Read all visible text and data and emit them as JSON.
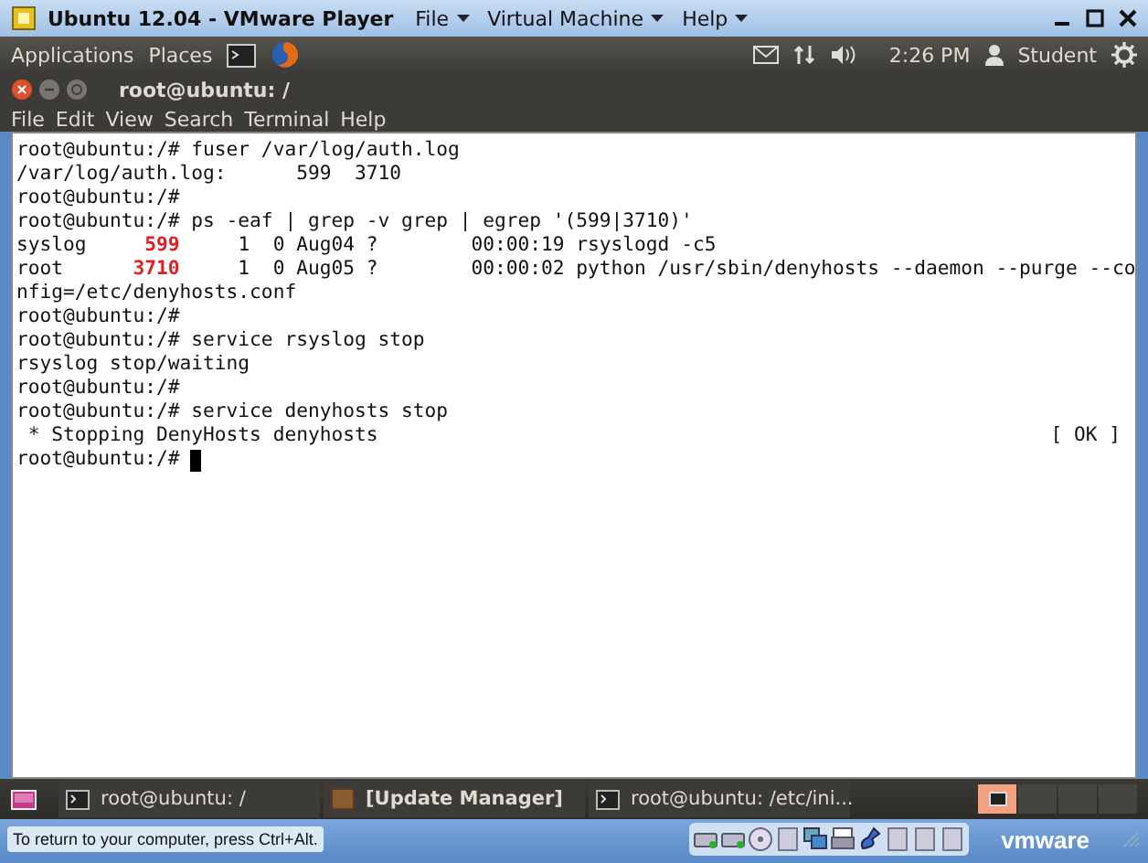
{
  "window": {
    "title": "Ubuntu 12.04 - VMware Player",
    "menus": [
      "File",
      "Virtual Machine",
      "Help"
    ]
  },
  "top_panel": {
    "menus": [
      "Applications",
      "Places"
    ],
    "clock": "2:26 PM",
    "user": "Student"
  },
  "terminal": {
    "title": "root@ubuntu: /",
    "menus": [
      "File",
      "Edit",
      "View",
      "Search",
      "Terminal",
      "Help"
    ],
    "lines": [
      {
        "parts": [
          {
            "kind": "plain",
            "text": "root@ubuntu:/# fuser /var/log/auth.log"
          }
        ]
      },
      {
        "parts": [
          {
            "kind": "plain",
            "text": "/var/log/auth.log:      599  3710"
          }
        ]
      },
      {
        "parts": [
          {
            "kind": "plain",
            "text": "root@ubuntu:/#"
          }
        ]
      },
      {
        "parts": [
          {
            "kind": "plain",
            "text": "root@ubuntu:/# ps -eaf | grep -v grep | egrep '(599|3710)'"
          }
        ]
      },
      {
        "parts": [
          {
            "kind": "plain",
            "text": "syslog     "
          },
          {
            "kind": "pid",
            "text": "599"
          },
          {
            "kind": "plain",
            "text": "     1  0 Aug04 ?        00:00:19 rsyslogd -c5"
          }
        ]
      },
      {
        "parts": [
          {
            "kind": "plain",
            "text": "root      "
          },
          {
            "kind": "pid",
            "text": "3710"
          },
          {
            "kind": "plain",
            "text": "     1  0 Aug05 ?        00:00:02 python /usr/sbin/denyhosts --daemon --purge --co"
          }
        ]
      },
      {
        "parts": [
          {
            "kind": "plain",
            "text": "nfig=/etc/denyhosts.conf"
          }
        ]
      },
      {
        "parts": [
          {
            "kind": "plain",
            "text": "root@ubuntu:/#"
          }
        ]
      },
      {
        "parts": [
          {
            "kind": "plain",
            "text": "root@ubuntu:/# service rsyslog stop"
          }
        ]
      },
      {
        "parts": [
          {
            "kind": "plain",
            "text": "rsyslog stop/waiting"
          }
        ]
      },
      {
        "parts": [
          {
            "kind": "plain",
            "text": "root@ubuntu:/#"
          }
        ]
      },
      {
        "parts": [
          {
            "kind": "plain",
            "text": "root@ubuntu:/# service denyhosts stop"
          }
        ]
      },
      {
        "parts": [
          {
            "kind": "plain",
            "text": " * Stopping DenyHosts denyhosts"
          }
        ],
        "status": "[ OK ]"
      },
      {
        "parts": [
          {
            "kind": "plain",
            "text": "root@ubuntu:/#"
          }
        ],
        "cursor": true
      }
    ]
  },
  "taskbar": {
    "tasks": [
      {
        "label": "root@ubuntu: /",
        "kind": "terminal"
      },
      {
        "label": "[Update Manager]",
        "kind": "app"
      },
      {
        "label": "root@ubuntu: /etc/ini...",
        "kind": "terminal"
      }
    ],
    "workspaces": [
      {
        "selected": true
      },
      {
        "selected": false
      },
      {
        "selected": false
      },
      {
        "selected": false
      }
    ]
  },
  "status_bar": {
    "hint": "To return to your computer, press Ctrl+Alt.",
    "logo": "vmware"
  }
}
